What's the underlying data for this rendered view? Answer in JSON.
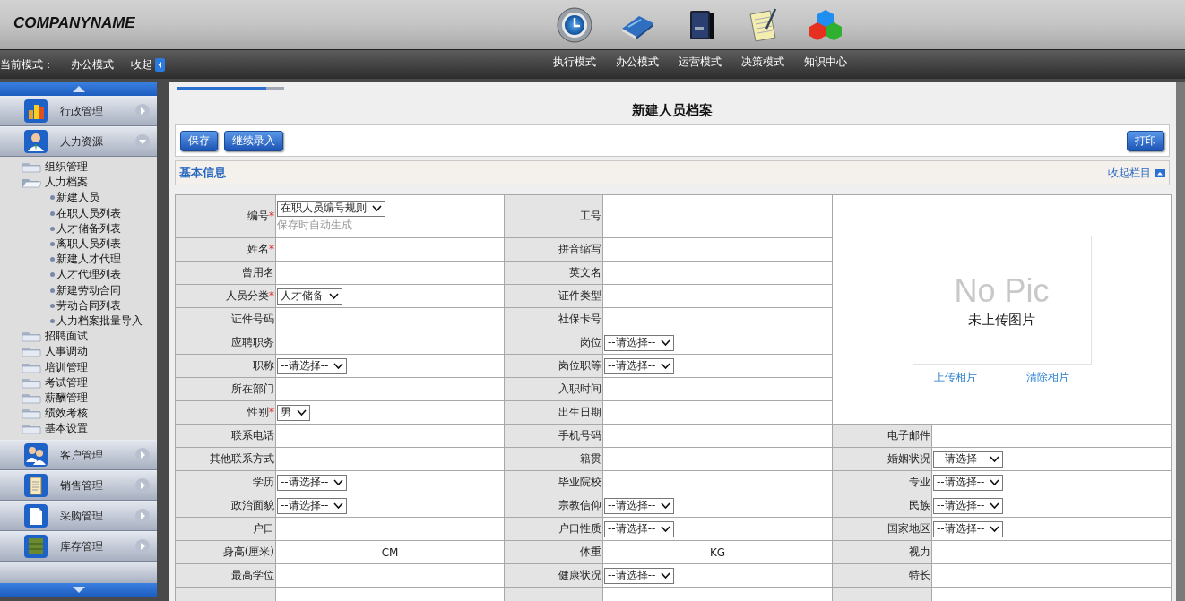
{
  "header": {
    "company": "COMPANYNAME",
    "current_mode_label": "当前模式：",
    "current_mode": "办公模式",
    "collapse": "收起",
    "modes": [
      {
        "label": "执行模式",
        "kind": "clock"
      },
      {
        "label": "办公模式",
        "kind": "book"
      },
      {
        "label": "运营模式",
        "kind": "box"
      },
      {
        "label": "决策模式",
        "kind": "notepad"
      },
      {
        "label": "知识中心",
        "kind": "cubes"
      }
    ]
  },
  "sidebar": {
    "groups": [
      {
        "label": "行政管理",
        "kind": "chart",
        "expanded": false
      },
      {
        "label": "人力资源",
        "kind": "person",
        "expanded": true,
        "children": [
          {
            "label": "组织管理",
            "expanded": false
          },
          {
            "label": "人力档案",
            "expanded": true,
            "children": [
              {
                "label": "新建人员"
              },
              {
                "label": "在职人员列表"
              },
              {
                "label": "人才储备列表"
              },
              {
                "label": "离职人员列表"
              },
              {
                "label": "新建人才代理"
              },
              {
                "label": "人才代理列表"
              },
              {
                "label": "新建劳动合同"
              },
              {
                "label": "劳动合同列表"
              },
              {
                "label": "人力档案批量导入"
              }
            ]
          },
          {
            "label": "招聘面试",
            "expanded": false
          },
          {
            "label": "人事调动",
            "expanded": false
          },
          {
            "label": "培训管理",
            "expanded": false
          },
          {
            "label": "考试管理",
            "expanded": false
          },
          {
            "label": "薪酬管理",
            "expanded": false
          },
          {
            "label": "绩效考核",
            "expanded": false
          },
          {
            "label": "基本设置",
            "expanded": false
          }
        ]
      },
      {
        "label": "客户管理",
        "kind": "people",
        "expanded": false
      },
      {
        "label": "销售管理",
        "kind": "clipboard",
        "expanded": false
      },
      {
        "label": "采购管理",
        "kind": "document",
        "expanded": false
      },
      {
        "label": "库存管理",
        "kind": "cabinet",
        "expanded": false
      }
    ]
  },
  "form": {
    "title": "新建人员档案",
    "buttons": [
      {
        "label": "保存"
      },
      {
        "label": "继续录入"
      }
    ],
    "print": "打印",
    "section": {
      "title": "基本信息",
      "collapse": "收起栏目"
    },
    "photo": {
      "placeholder": "No Pic",
      "caption": "未上传图片",
      "links": [
        "上传相片",
        "清除相片"
      ]
    },
    "rows": [
      [
        {
          "label": "编号",
          "required_mark": "*",
          "kind": "select",
          "value": "在职人员编号规则",
          "hint": "保存时自动生成"
        },
        {
          "label": "工号",
          "kind": "text"
        }
      ],
      [
        {
          "label": "姓名",
          "required_mark": "*",
          "kind": "text"
        },
        {
          "label": "拼音缩写",
          "kind": "text"
        }
      ],
      [
        {
          "label": "曾用名",
          "kind": "text"
        },
        {
          "label": "英文名",
          "kind": "text"
        }
      ],
      [
        {
          "label": "人员分类",
          "required_mark": "*",
          "kind": "select",
          "value": "人才储备"
        },
        {
          "label": "证件类型",
          "kind": "text"
        }
      ],
      [
        {
          "label": "证件号码",
          "kind": "text"
        },
        {
          "label": "社保卡号",
          "kind": "text"
        }
      ],
      [
        {
          "label": "应聘职务",
          "kind": "text"
        },
        {
          "label": "岗位",
          "kind": "select",
          "value": "--请选择--"
        }
      ],
      [
        {
          "label": "职称",
          "kind": "select",
          "value": "--请选择--"
        },
        {
          "label": "岗位职等",
          "kind": "select",
          "value": "--请选择--"
        }
      ],
      [
        {
          "label": "所在部门",
          "kind": "text"
        },
        {
          "label": "入职时间",
          "kind": "text"
        }
      ],
      [
        {
          "label": "性别",
          "required_mark": "*",
          "kind": "select",
          "value": "男"
        },
        {
          "label": "出生日期",
          "kind": "text"
        }
      ],
      [
        {
          "label": "联系电话",
          "kind": "text"
        },
        {
          "label": "手机号码",
          "kind": "text"
        },
        {
          "label": "电子邮件",
          "kind": "text"
        }
      ],
      [
        {
          "label": "其他联系方式",
          "kind": "text"
        },
        {
          "label": "籍贯",
          "kind": "text"
        },
        {
          "label": "婚姻状况",
          "kind": "select",
          "value": "--请选择--"
        }
      ],
      [
        {
          "label": "学历",
          "kind": "select",
          "value": "--请选择--"
        },
        {
          "label": "毕业院校",
          "kind": "text"
        },
        {
          "label": "专业",
          "kind": "select",
          "value": "--请选择--"
        }
      ],
      [
        {
          "label": "政治面貌",
          "kind": "select",
          "value": "--请选择--"
        },
        {
          "label": "宗教信仰",
          "kind": "select",
          "value": "--请选择--"
        },
        {
          "label": "民族",
          "kind": "select",
          "value": "--请选择--"
        }
      ],
      [
        {
          "label": "户口",
          "kind": "text"
        },
        {
          "label": "户口性质",
          "kind": "select",
          "value": "--请选择--"
        },
        {
          "label": "国家地区",
          "kind": "select",
          "value": "--请选择--"
        }
      ],
      [
        {
          "label": "身高(厘米)",
          "kind": "unit",
          "value": "CM"
        },
        {
          "label": "体重",
          "kind": "unit",
          "value": "KG"
        },
        {
          "label": "视力",
          "kind": "text"
        }
      ],
      [
        {
          "label": "最高学位",
          "kind": "text"
        },
        {
          "label": "健康状况",
          "kind": "select",
          "value": "--请选择--"
        },
        {
          "label": "特长",
          "kind": "text"
        }
      ]
    ]
  }
}
